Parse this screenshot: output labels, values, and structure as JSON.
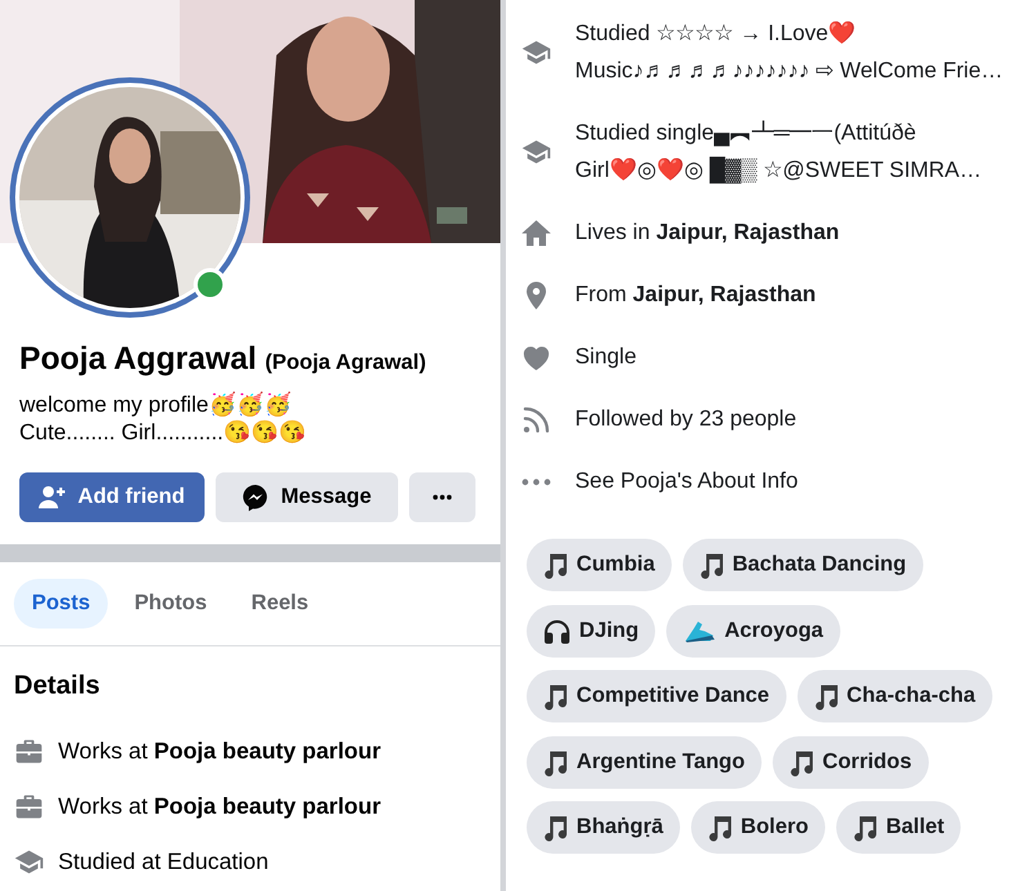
{
  "profile": {
    "name": "Pooja Aggrawal",
    "alt_name": "(Pooja Agrawal)",
    "online": true,
    "bio": [
      "welcome my profile🥳🥳🥳",
      "Cute........ Girl...........😘😘😘"
    ]
  },
  "actions": [
    {
      "kind": "add_friend",
      "label": "Add friend"
    },
    {
      "kind": "message",
      "label": "Message"
    },
    {
      "kind": "more"
    }
  ],
  "tabs": [
    {
      "label": "Posts",
      "selected": true
    },
    {
      "label": "Photos",
      "selected": false
    },
    {
      "label": "Reels",
      "selected": false
    }
  ],
  "details": {
    "heading": "Details",
    "items": [
      {
        "kind": "work",
        "text": "Works at **Pooja beauty parlour**"
      },
      {
        "kind": "work",
        "text": "Works at **Pooja beauty parlour**"
      },
      {
        "kind": "study",
        "text": "Studied at Education"
      }
    ]
  },
  "about": [
    {
      "kind": "study",
      "text": "Studied ☆☆☆☆ → I.Love❤️\nMusic♪♬♬♬♬♪♪♪♪♪♪♪ ⇨ WelCome Frie…"
    },
    {
      "kind": "study",
      "text": "Studied single▄︻┻═━一(Attitúðè\nGirl❤️◎❤️◎ █▓▒ ☆@SWEET SIMRA…"
    },
    {
      "kind": "home",
      "text": "Lives in **Jaipur, Rajasthan**"
    },
    {
      "kind": "location",
      "text": "From **Jaipur, Rajasthan**"
    },
    {
      "kind": "relationship",
      "text": "Single"
    },
    {
      "kind": "followers",
      "text": "Followed by 23 people"
    },
    {
      "kind": "more",
      "text": "See Pooja's About Info"
    }
  ],
  "interests": [
    {
      "kind": "music",
      "label": "Cumbia"
    },
    {
      "kind": "music",
      "label": "Bachata Dancing"
    },
    {
      "kind": "headphones",
      "label": "DJing"
    },
    {
      "kind": "shoe",
      "label": "Acroyoga"
    },
    {
      "kind": "music",
      "label": "Competitive Dance"
    },
    {
      "kind": "music",
      "label": "Cha-cha-cha"
    },
    {
      "kind": "music",
      "label": "Argentine Tango"
    },
    {
      "kind": "music",
      "label": "Corridos"
    },
    {
      "kind": "music",
      "label": "Bhaṅgṛā"
    },
    {
      "kind": "music",
      "label": "Bolero"
    },
    {
      "kind": "music",
      "label": "Ballet"
    }
  ]
}
